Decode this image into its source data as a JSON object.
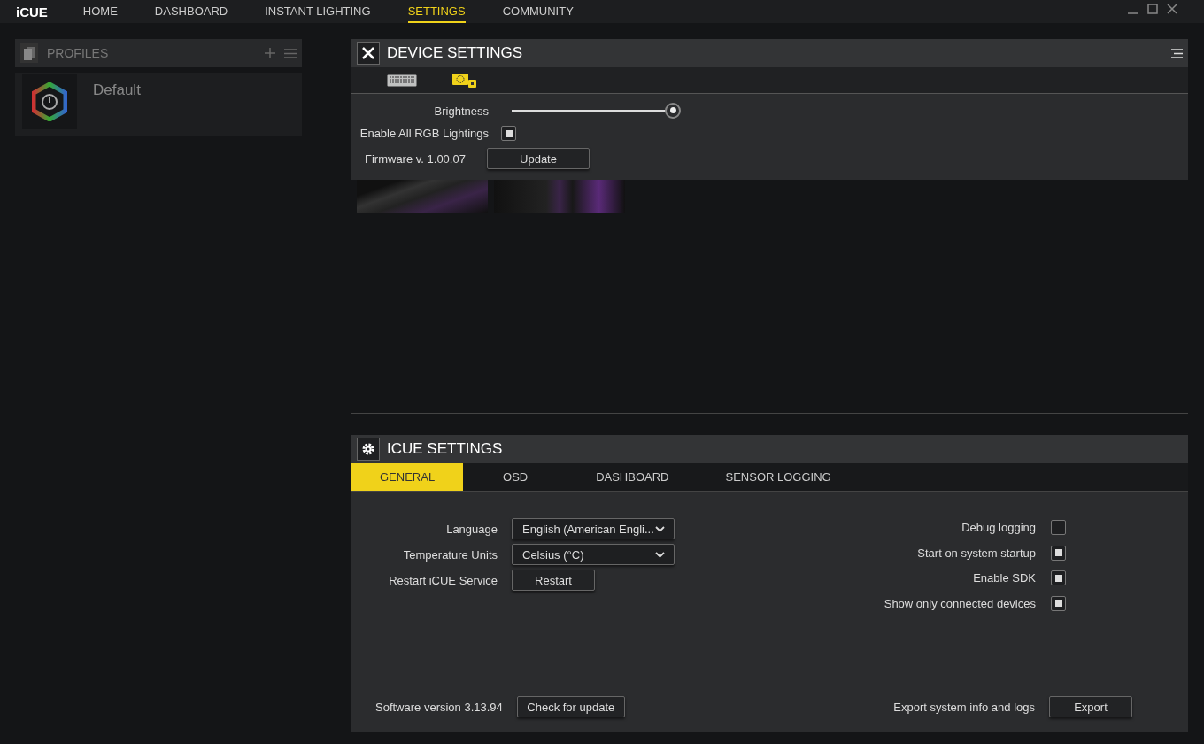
{
  "app": {
    "logo": "iCUE"
  },
  "nav": [
    {
      "label": "HOME",
      "selected": false
    },
    {
      "label": "DASHBOARD",
      "selected": false
    },
    {
      "label": "INSTANT LIGHTING",
      "selected": false
    },
    {
      "label": "SETTINGS",
      "selected": true
    },
    {
      "label": "COMMUNITY",
      "selected": false
    }
  ],
  "profiles": {
    "title": "PROFILES",
    "items": [
      {
        "name": "Default",
        "selected": true
      }
    ]
  },
  "device_settings": {
    "title": "DEVICE SETTINGS",
    "devices": [
      {
        "kind": "keyboard",
        "selected": false
      },
      {
        "kind": "controller",
        "selected": true
      }
    ],
    "brightness": {
      "label": "Brightness",
      "level": 0.99
    },
    "rgb": {
      "label": "Enable All RGB Lightings",
      "checked": true
    },
    "firmware": {
      "label": "Firmware v. 1.00.07",
      "button": "Update"
    },
    "thumbnails": [
      {
        "kind": "keyboard"
      },
      {
        "kind": "strip"
      }
    ]
  },
  "icue_settings": {
    "title": "ICUE SETTINGS",
    "tabs": [
      {
        "label": "GENERAL",
        "selected": true
      },
      {
        "label": "OSD",
        "selected": false
      },
      {
        "label": "DASHBOARD",
        "selected": false
      },
      {
        "label": "SENSOR LOGGING",
        "selected": false
      }
    ],
    "left": [
      {
        "kind": "select",
        "label": "Language",
        "value": "English (American Engli..."
      },
      {
        "kind": "select",
        "label": "Temperature Units",
        "value": "Celsius (°C)"
      },
      {
        "kind": "button",
        "label": "Restart iCUE Service",
        "button": "Restart"
      }
    ],
    "right": [
      {
        "label": "Debug logging",
        "checked": false
      },
      {
        "label": "Start on system startup",
        "checked": true
      },
      {
        "label": "Enable SDK",
        "checked": true
      },
      {
        "label": "Show only connected devices",
        "checked": true
      }
    ],
    "version": {
      "label": "Software version 3.13.94",
      "button": "Check for update"
    },
    "export": {
      "label": "Export system info and logs",
      "button": "Export"
    }
  }
}
